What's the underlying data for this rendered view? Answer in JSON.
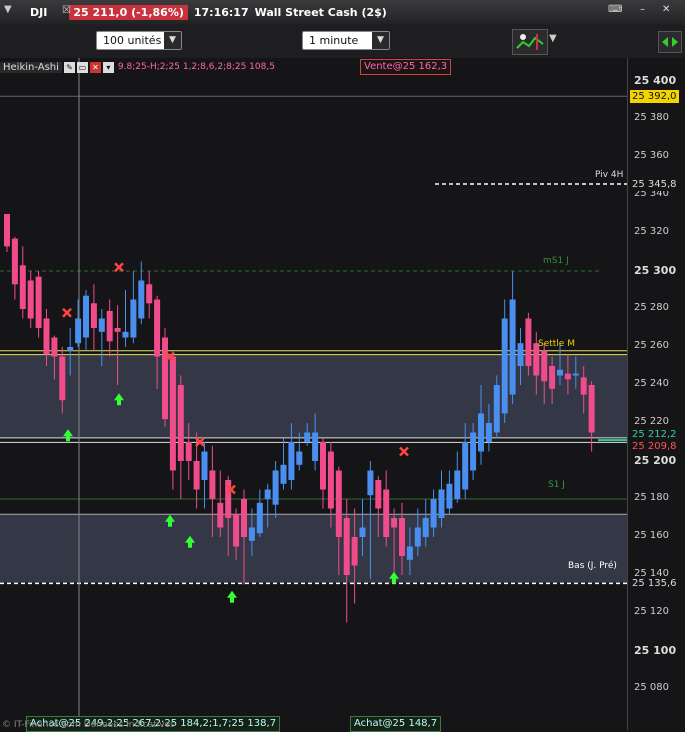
{
  "topbar": {
    "symbol": "DJI",
    "price_change": "25 211,0 (-1,86%)",
    "time": "17:16:17",
    "description": "Wall Street Cash (2$)"
  },
  "toolbar": {
    "quantity": "100 unités",
    "timeframe": "1 minute"
  },
  "legend": {
    "indicator": "Heikin-Ashi",
    "overlay_text": "9.8;25-H;2;25 1,2;8,6,2;8;25 108,5",
    "sell_box": "Vente@25 162,3"
  },
  "axis": {
    "ticks": [
      "25 400",
      "25 380",
      "25 360",
      "25 340",
      "25 320",
      "25 300",
      "25 280",
      "25 260",
      "25 240",
      "25 220",
      "25 200",
      "25 180",
      "25 160",
      "25 140",
      "25 120",
      "25 100",
      "25 080"
    ],
    "tags": {
      "price_current": "25 392,0",
      "piv4h": "25 345,8",
      "p1": "25 212,2",
      "p2": "25 209,8",
      "low_prev": "25 135,6"
    }
  },
  "levels": {
    "ms1": "mS1 J",
    "piv4h": "Piv 4H",
    "settle": "Settle M",
    "s1": "S1 J",
    "low_prev": "Bas (J. Pré)"
  },
  "bottom": {
    "buy_box1": "Achat@25 249,2;25 267,2;25 184,2;1,7;25 138,7",
    "buy_box2": "Achat@25 148,7",
    "copyright": "© IT-Finance.com Données indicatives"
  },
  "colors": {
    "bull": "#4a8ef0",
    "bear": "#f04c8c",
    "price_tag": "#f2d400",
    "red_tag": "#c8323c"
  },
  "chart_data": {
    "type": "candlestick",
    "y_range": [
      25070,
      25410
    ],
    "candles": [
      {
        "o": 25330,
        "h": 25330,
        "l": 25310,
        "c": 25313,
        "bull": false
      },
      {
        "o": 25317,
        "h": 25318,
        "l": 25285,
        "c": 25293,
        "bull": false
      },
      {
        "o": 25303,
        "h": 25313,
        "l": 25275,
        "c": 25280,
        "bull": false
      },
      {
        "o": 25295,
        "h": 25300,
        "l": 25270,
        "c": 25275,
        "bull": false
      },
      {
        "o": 25297,
        "h": 25300,
        "l": 25265,
        "c": 25270,
        "bull": false
      },
      {
        "o": 25275,
        "h": 25280,
        "l": 25250,
        "c": 25256,
        "bull": false
      },
      {
        "o": 25265,
        "h": 25266,
        "l": 25243,
        "c": 25255,
        "bull": false
      },
      {
        "o": 25255,
        "h": 25260,
        "l": 25225,
        "c": 25232,
        "bull": false
      },
      {
        "o": 25258,
        "h": 25270,
        "l": 25245,
        "c": 25260,
        "bull": true
      },
      {
        "o": 25262,
        "h": 25285,
        "l": 25260,
        "c": 25275,
        "bull": true
      },
      {
        "o": 25265,
        "h": 25290,
        "l": 25258,
        "c": 25287,
        "bull": true
      },
      {
        "o": 25283,
        "h": 25293,
        "l": 25258,
        "c": 25270,
        "bull": false
      },
      {
        "o": 25275,
        "h": 25280,
        "l": 25250,
        "c": 25268,
        "bull": true
      },
      {
        "o": 25279,
        "h": 25285,
        "l": 25255,
        "c": 25263,
        "bull": false
      },
      {
        "o": 25268,
        "h": 25282,
        "l": 25240,
        "c": 25270,
        "bull": false
      },
      {
        "o": 25268,
        "h": 25290,
        "l": 25260,
        "c": 25265,
        "bull": true
      },
      {
        "o": 25265,
        "h": 25300,
        "l": 25262,
        "c": 25285,
        "bull": true
      },
      {
        "o": 25275,
        "h": 25305,
        "l": 25272,
        "c": 25295,
        "bull": true
      },
      {
        "o": 25293,
        "h": 25300,
        "l": 25275,
        "c": 25283,
        "bull": false
      },
      {
        "o": 25285,
        "h": 25287,
        "l": 25238,
        "c": 25255,
        "bull": false
      },
      {
        "o": 25265,
        "h": 25270,
        "l": 25218,
        "c": 25222,
        "bull": false
      },
      {
        "o": 25255,
        "h": 25258,
        "l": 25185,
        "c": 25195,
        "bull": false
      },
      {
        "o": 25240,
        "h": 25245,
        "l": 25180,
        "c": 25200,
        "bull": false
      },
      {
        "o": 25210,
        "h": 25220,
        "l": 25190,
        "c": 25200,
        "bull": false
      },
      {
        "o": 25200,
        "h": 25215,
        "l": 25175,
        "c": 25185,
        "bull": false
      },
      {
        "o": 25205,
        "h": 25210,
        "l": 25175,
        "c": 25190,
        "bull": true
      },
      {
        "o": 25195,
        "h": 25208,
        "l": 25160,
        "c": 25180,
        "bull": false
      },
      {
        "o": 25178,
        "h": 25195,
        "l": 25160,
        "c": 25165,
        "bull": false
      },
      {
        "o": 25190,
        "h": 25192,
        "l": 25150,
        "c": 25170,
        "bull": false
      },
      {
        "o": 25172,
        "h": 25175,
        "l": 25148,
        "c": 25155,
        "bull": false
      },
      {
        "o": 25180,
        "h": 25185,
        "l": 25135,
        "c": 25160,
        "bull": false
      },
      {
        "o": 25158,
        "h": 25175,
        "l": 25150,
        "c": 25165,
        "bull": true
      },
      {
        "o": 25162,
        "h": 25185,
        "l": 25160,
        "c": 25178,
        "bull": true
      },
      {
        "o": 25180,
        "h": 25188,
        "l": 25165,
        "c": 25185,
        "bull": true
      },
      {
        "o": 25177,
        "h": 25200,
        "l": 25170,
        "c": 25195,
        "bull": true
      },
      {
        "o": 25188,
        "h": 25212,
        "l": 25185,
        "c": 25198,
        "bull": true
      },
      {
        "o": 25190,
        "h": 25220,
        "l": 25185,
        "c": 25210,
        "bull": true
      },
      {
        "o": 25205,
        "h": 25215,
        "l": 25195,
        "c": 25198,
        "bull": true
      },
      {
        "o": 25210,
        "h": 25220,
        "l": 25208,
        "c": 25215,
        "bull": true
      },
      {
        "o": 25215,
        "h": 25225,
        "l": 25195,
        "c": 25200,
        "bull": true
      },
      {
        "o": 25210,
        "h": 25212,
        "l": 25175,
        "c": 25185,
        "bull": false
      },
      {
        "o": 25205,
        "h": 25210,
        "l": 25165,
        "c": 25175,
        "bull": false
      },
      {
        "o": 25195,
        "h": 25197,
        "l": 25140,
        "c": 25160,
        "bull": false
      },
      {
        "o": 25170,
        "h": 25180,
        "l": 25115,
        "c": 25140,
        "bull": false
      },
      {
        "o": 25160,
        "h": 25175,
        "l": 25125,
        "c": 25145,
        "bull": false
      },
      {
        "o": 25160,
        "h": 25180,
        "l": 25150,
        "c": 25165,
        "bull": true
      },
      {
        "o": 25182,
        "h": 25200,
        "l": 25138,
        "c": 25195,
        "bull": true
      },
      {
        "o": 25190,
        "h": 25192,
        "l": 25160,
        "c": 25175,
        "bull": false
      },
      {
        "o": 25185,
        "h": 25195,
        "l": 25155,
        "c": 25160,
        "bull": false
      },
      {
        "o": 25170,
        "h": 25175,
        "l": 25140,
        "c": 25165,
        "bull": false
      },
      {
        "o": 25170,
        "h": 25178,
        "l": 25140,
        "c": 25150,
        "bull": false
      },
      {
        "o": 25148,
        "h": 25165,
        "l": 25140,
        "c": 25155,
        "bull": true
      },
      {
        "o": 25155,
        "h": 25175,
        "l": 25150,
        "c": 25165,
        "bull": true
      },
      {
        "o": 25160,
        "h": 25180,
        "l": 25155,
        "c": 25170,
        "bull": true
      },
      {
        "o": 25165,
        "h": 25185,
        "l": 25160,
        "c": 25180,
        "bull": true
      },
      {
        "o": 25170,
        "h": 25195,
        "l": 25165,
        "c": 25185,
        "bull": true
      },
      {
        "o": 25175,
        "h": 25195,
        "l": 25172,
        "c": 25188,
        "bull": true
      },
      {
        "o": 25180,
        "h": 25205,
        "l": 25178,
        "c": 25195,
        "bull": true
      },
      {
        "o": 25185,
        "h": 25220,
        "l": 25180,
        "c": 25210,
        "bull": true
      },
      {
        "o": 25195,
        "h": 25220,
        "l": 25190,
        "c": 25215,
        "bull": true
      },
      {
        "o": 25205,
        "h": 25240,
        "l": 25198,
        "c": 25225,
        "bull": true
      },
      {
        "o": 25210,
        "h": 25230,
        "l": 25205,
        "c": 25220,
        "bull": true
      },
      {
        "o": 25215,
        "h": 25245,
        "l": 25212,
        "c": 25240,
        "bull": true
      },
      {
        "o": 25225,
        "h": 25285,
        "l": 25220,
        "c": 25275,
        "bull": true
      },
      {
        "o": 25235,
        "h": 25300,
        "l": 25230,
        "c": 25285,
        "bull": true
      },
      {
        "o": 25250,
        "h": 25270,
        "l": 25240,
        "c": 25262,
        "bull": true
      },
      {
        "o": 25275,
        "h": 25278,
        "l": 25245,
        "c": 25250,
        "bull": false
      },
      {
        "o": 25262,
        "h": 25268,
        "l": 25235,
        "c": 25245,
        "bull": false
      },
      {
        "o": 25258,
        "h": 25262,
        "l": 25230,
        "c": 25242,
        "bull": false
      },
      {
        "o": 25250,
        "h": 25255,
        "l": 25230,
        "c": 25238,
        "bull": false
      },
      {
        "o": 25245,
        "h": 25262,
        "l": 25240,
        "c": 25248,
        "bull": true
      },
      {
        "o": 25246,
        "h": 25256,
        "l": 25235,
        "c": 25243,
        "bull": false
      },
      {
        "o": 25245,
        "h": 25255,
        "l": 25238,
        "c": 25246,
        "bull": true
      },
      {
        "o": 25244,
        "h": 25250,
        "l": 25225,
        "c": 25235,
        "bull": false
      },
      {
        "o": 25240,
        "h": 25242,
        "l": 25205,
        "c": 25215,
        "bull": false
      }
    ]
  }
}
